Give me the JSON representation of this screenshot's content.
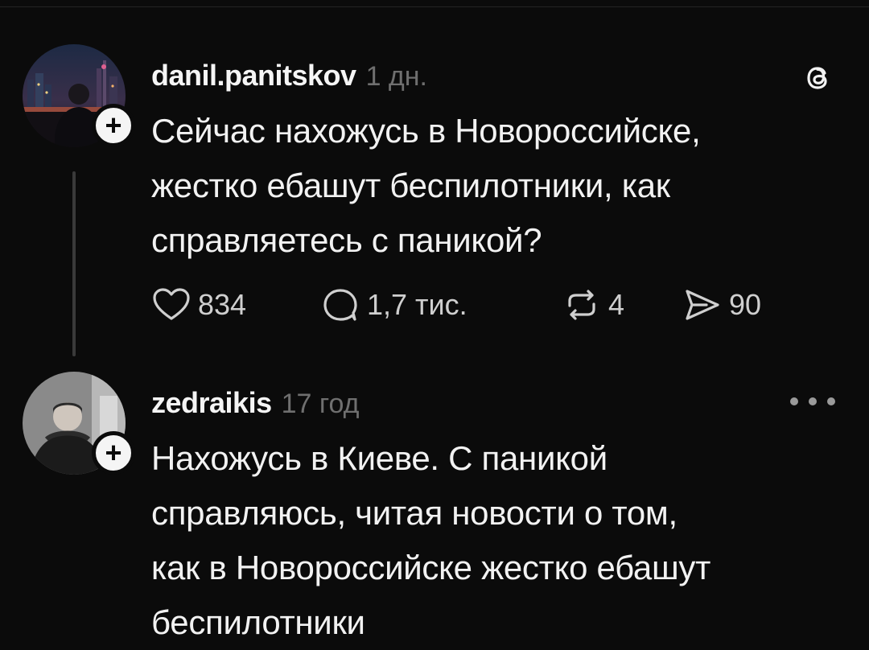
{
  "posts": [
    {
      "username": "danil.panitskov",
      "time": "1 дн.",
      "text": "Сейчас нахожусь в Новороссийске,\nжестко ебашут беспилотники, как\nсправляетесь с паникой?",
      "likes": "834",
      "replies": "1,7 тис.",
      "reposts": "4",
      "shares": "90",
      "corner_icon": "threads-logo-icon"
    },
    {
      "username": "zedraikis",
      "time": "17 год",
      "text": "Нахожусь в Киеве. С паникой\nсправляюсь, читая новости о том,\nкак в Новороссийске жестко ебашут\nбеспилотники",
      "corner_icon": "more-options-icon"
    }
  ],
  "follow_badge": "+",
  "colors": {
    "background": "#0b0b0b",
    "text": "#f2f2f2",
    "muted": "#6f6f6f",
    "thread_line": "#3a3a3a"
  }
}
